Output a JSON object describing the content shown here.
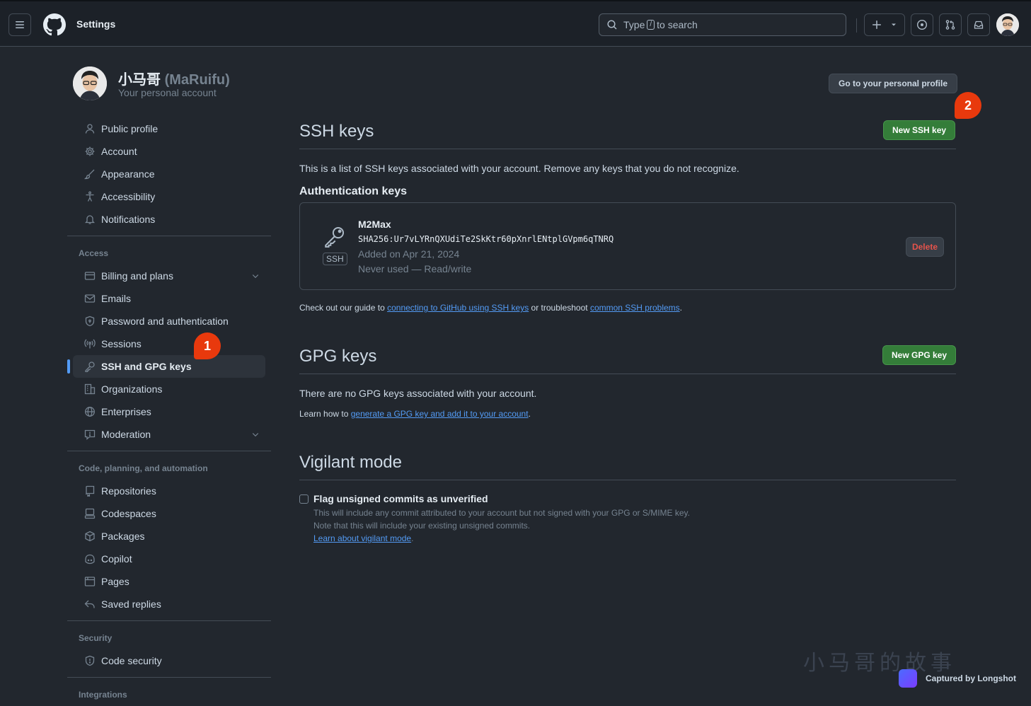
{
  "header": {
    "title": "Settings",
    "search_prefix": "Type",
    "search_key": "/",
    "search_suffix": "to search"
  },
  "profile": {
    "name": "小马哥",
    "login": "(MaRuifu)",
    "subtitle": "Your personal account",
    "go_profile_label": "Go to your personal profile"
  },
  "sidebar": {
    "items_top": [
      {
        "label": "Public profile",
        "icon": "person-icon"
      },
      {
        "label": "Account",
        "icon": "gear-icon"
      },
      {
        "label": "Appearance",
        "icon": "paintbrush-icon"
      },
      {
        "label": "Accessibility",
        "icon": "accessibility-icon"
      },
      {
        "label": "Notifications",
        "icon": "bell-icon"
      }
    ],
    "access_heading": "Access",
    "items_access": [
      {
        "label": "Billing and plans",
        "icon": "credit-card-icon"
      },
      {
        "label": "Emails",
        "icon": "mail-icon"
      },
      {
        "label": "Password and authentication",
        "icon": "shield-lock-icon"
      },
      {
        "label": "Sessions",
        "icon": "broadcast-icon"
      },
      {
        "label": "SSH and GPG keys",
        "icon": "key-icon"
      },
      {
        "label": "Organizations",
        "icon": "organization-icon"
      },
      {
        "label": "Enterprises",
        "icon": "globe-icon"
      },
      {
        "label": "Moderation",
        "icon": "report-icon"
      }
    ],
    "code_heading": "Code, planning, and automation",
    "items_code": [
      {
        "label": "Repositories",
        "icon": "repo-icon"
      },
      {
        "label": "Codespaces",
        "icon": "codespaces-icon"
      },
      {
        "label": "Packages",
        "icon": "package-icon"
      },
      {
        "label": "Copilot",
        "icon": "copilot-icon"
      },
      {
        "label": "Pages",
        "icon": "browser-icon"
      },
      {
        "label": "Saved replies",
        "icon": "reply-icon"
      }
    ],
    "security_heading": "Security",
    "items_security": [
      {
        "label": "Code security",
        "icon": "shield-icon"
      }
    ],
    "integrations_heading": "Integrations"
  },
  "annotations": {
    "badge1": "1",
    "badge2": "2"
  },
  "ssh": {
    "title": "SSH keys",
    "new_button": "New SSH key",
    "description": "This is a list of SSH keys associated with your account. Remove any keys that you do not recognize.",
    "auth_heading": "Authentication keys",
    "key": {
      "name": "M2Max",
      "fingerprint": "SHA256:Ur7vLYRnQXUdiTe2SkKtr60pXnrlENtplGVpm6qTNRQ",
      "added": "Added on Apr 21, 2024",
      "usage": "Never used — Read/write",
      "type_label": "SSH",
      "delete_label": "Delete"
    },
    "guide_prefix": "Check out our guide to",
    "guide_link1": "connecting to GitHub using SSH keys",
    "guide_middle": "or troubleshoot",
    "guide_link2": "common SSH problems",
    "guide_suffix": "."
  },
  "gpg": {
    "title": "GPG keys",
    "new_button": "New GPG key",
    "empty": "There are no GPG keys associated with your account.",
    "learn_prefix": "Learn how to",
    "learn_link": "generate a GPG key and add it to your account",
    "learn_suffix": "."
  },
  "vigilant": {
    "title": "Vigilant mode",
    "checkbox_label": "Flag unsigned commits as unverified",
    "checked": false,
    "desc1": "This will include any commit attributed to your account but not signed with your GPG or S/MIME key.",
    "desc2": "Note that this will include your existing unsigned commits.",
    "learn_link": "Learn about vigilant mode",
    "learn_suffix": "."
  },
  "watermark": {
    "text": "小马哥的故事",
    "captured": "Captured by Longshot"
  }
}
